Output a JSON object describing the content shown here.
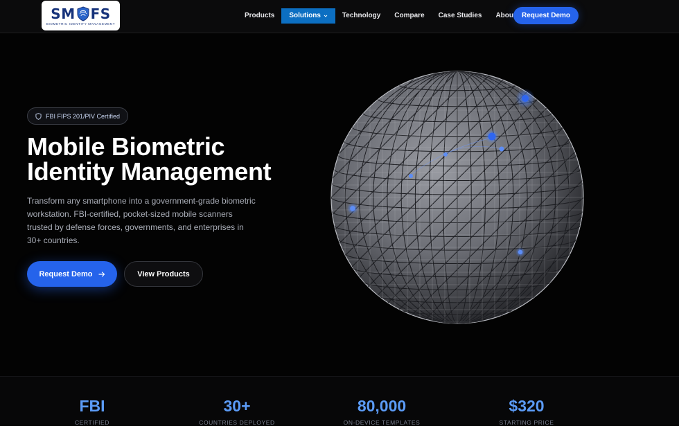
{
  "nav": {
    "logo": {
      "word": "SMFS",
      "tagline": "Biometric Identity Management"
    },
    "links": [
      {
        "label": "Products"
      },
      {
        "label": "Solutions",
        "active": true
      },
      {
        "label": "Technology"
      },
      {
        "label": "Compare"
      },
      {
        "label": "Case Studies"
      },
      {
        "label": "About"
      }
    ],
    "cta": "Request Demo"
  },
  "hero": {
    "badge": "FBI FIPS 201/PIV Certified",
    "title_line1": "Mobile Biometric",
    "title_line2": "Identity Management",
    "description": "Transform any smartphone into a government-grade biometric workstation. FBI-certified, pocket-sized mobile scanners trusted by defense forces, governments, and enterprises in 30+ countries.",
    "primary_button": "Request Demo",
    "secondary_button": "View Products"
  },
  "stats": [
    {
      "value": "FBI",
      "label": "Certified"
    },
    {
      "value": "30+",
      "label": "Countries Deployed"
    },
    {
      "value": "80,000",
      "label": "On-Device Templates"
    },
    {
      "value": "$320",
      "label": "Starting Price"
    }
  ],
  "colors": {
    "accent": "#2563eb",
    "active_nav": "#0c6fc2",
    "stat_value": "#5b9bf6",
    "background": "#030303"
  },
  "icons": {
    "badge": "shield-icon",
    "primary_button": "arrow-right-icon",
    "solutions_menu": "chevron-down-icon"
  }
}
